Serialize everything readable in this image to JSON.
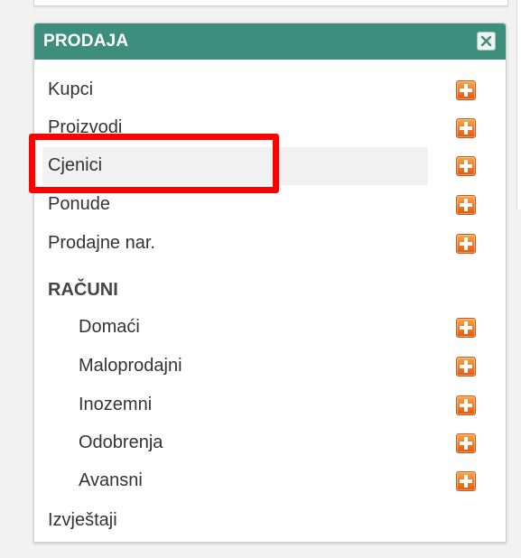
{
  "panel": {
    "title": "PRODAJA"
  },
  "menu": {
    "items": [
      {
        "label": "Kupci"
      },
      {
        "label": "Proizvodi"
      },
      {
        "label": "Cjenici"
      },
      {
        "label": "Ponude"
      },
      {
        "label": "Prodajne nar."
      }
    ],
    "section": {
      "title": "RAČUNI",
      "items": [
        {
          "label": "Domaći"
        },
        {
          "label": "Maloprodajni"
        },
        {
          "label": "Inozemni"
        },
        {
          "label": "Odobrenja"
        },
        {
          "label": "Avansni"
        }
      ]
    },
    "footer_item": {
      "label": "Izvještaji"
    }
  },
  "icons": {
    "add": "plus-icon",
    "close": "close-icon"
  },
  "colors": {
    "header": "#3d8e7c",
    "add_icon": "#ef7a22",
    "highlight": "#ff0000",
    "hover_row": "#f1f1f1"
  }
}
